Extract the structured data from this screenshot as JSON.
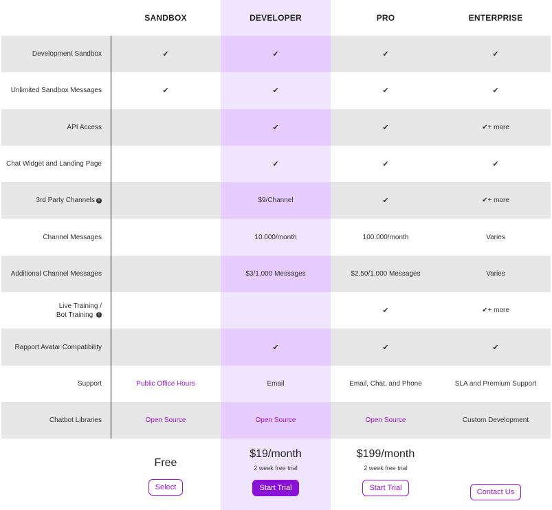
{
  "plans": [
    {
      "name": "SANDBOX"
    },
    {
      "name": "DEVELOPER"
    },
    {
      "name": "PRO"
    },
    {
      "name": "ENTERPRISE"
    }
  ],
  "rows": [
    {
      "label": "Development Sandbox",
      "values": [
        "✔",
        "✔",
        "✔",
        "✔"
      ]
    },
    {
      "label": "Unlimited Sandbox Messages",
      "values": [
        "✔",
        "✔",
        "✔",
        "✔"
      ]
    },
    {
      "label": "API Access",
      "values": [
        "",
        "✔",
        "✔",
        "✔+ more"
      ]
    },
    {
      "label": "Chat Widget and Landing Page",
      "values": [
        "",
        "✔",
        "✔",
        "✔"
      ]
    },
    {
      "label": "3rd Party Channels",
      "values": [
        "",
        "$9/Channel",
        "✔",
        "✔+ more"
      ]
    },
    {
      "label": "Channel Messages",
      "values": [
        "",
        "10.000/month",
        "100.000/month",
        "Varies"
      ]
    },
    {
      "label": "Additional Channel Messages",
      "values": [
        "",
        "$3/1,000 Messages",
        "$2.50/1,000 Messages",
        "Varies"
      ]
    },
    {
      "label_line1": "Live Training /",
      "label_line2": "Bot Training",
      "values": [
        "",
        "",
        "✔",
        "✔+ more"
      ]
    },
    {
      "label": "Rapport Avatar Compatibility",
      "values": [
        "",
        "✔",
        "✔",
        "✔"
      ]
    },
    {
      "label": "Support",
      "values": [
        "Public Office Hours",
        "Email",
        "Email, Chat, and Phone",
        "SLA and Premium Support"
      ]
    },
    {
      "label": "Chatbot Libraries",
      "values": [
        "Open Source",
        "Open Source",
        "Open Source",
        "Custom Development"
      ]
    }
  ],
  "footer": {
    "sandbox": {
      "price": "Free",
      "button": "Select"
    },
    "developer": {
      "price": "$19/month",
      "note": "2 week free trial",
      "button": "Start Trial"
    },
    "pro": {
      "price": "$199/month",
      "note": "2 week free trial",
      "button": "Start Trial"
    },
    "enterprise": {
      "button": "Contact Us"
    }
  },
  "info_icon": "info-circle-icon",
  "colors": {
    "accent": "#8a11d6",
    "link": "#9b14d6",
    "highlight_column": "#efe5ff",
    "highlight_shaded": "#e6ccff",
    "row_shade": "#e7e7e7"
  }
}
